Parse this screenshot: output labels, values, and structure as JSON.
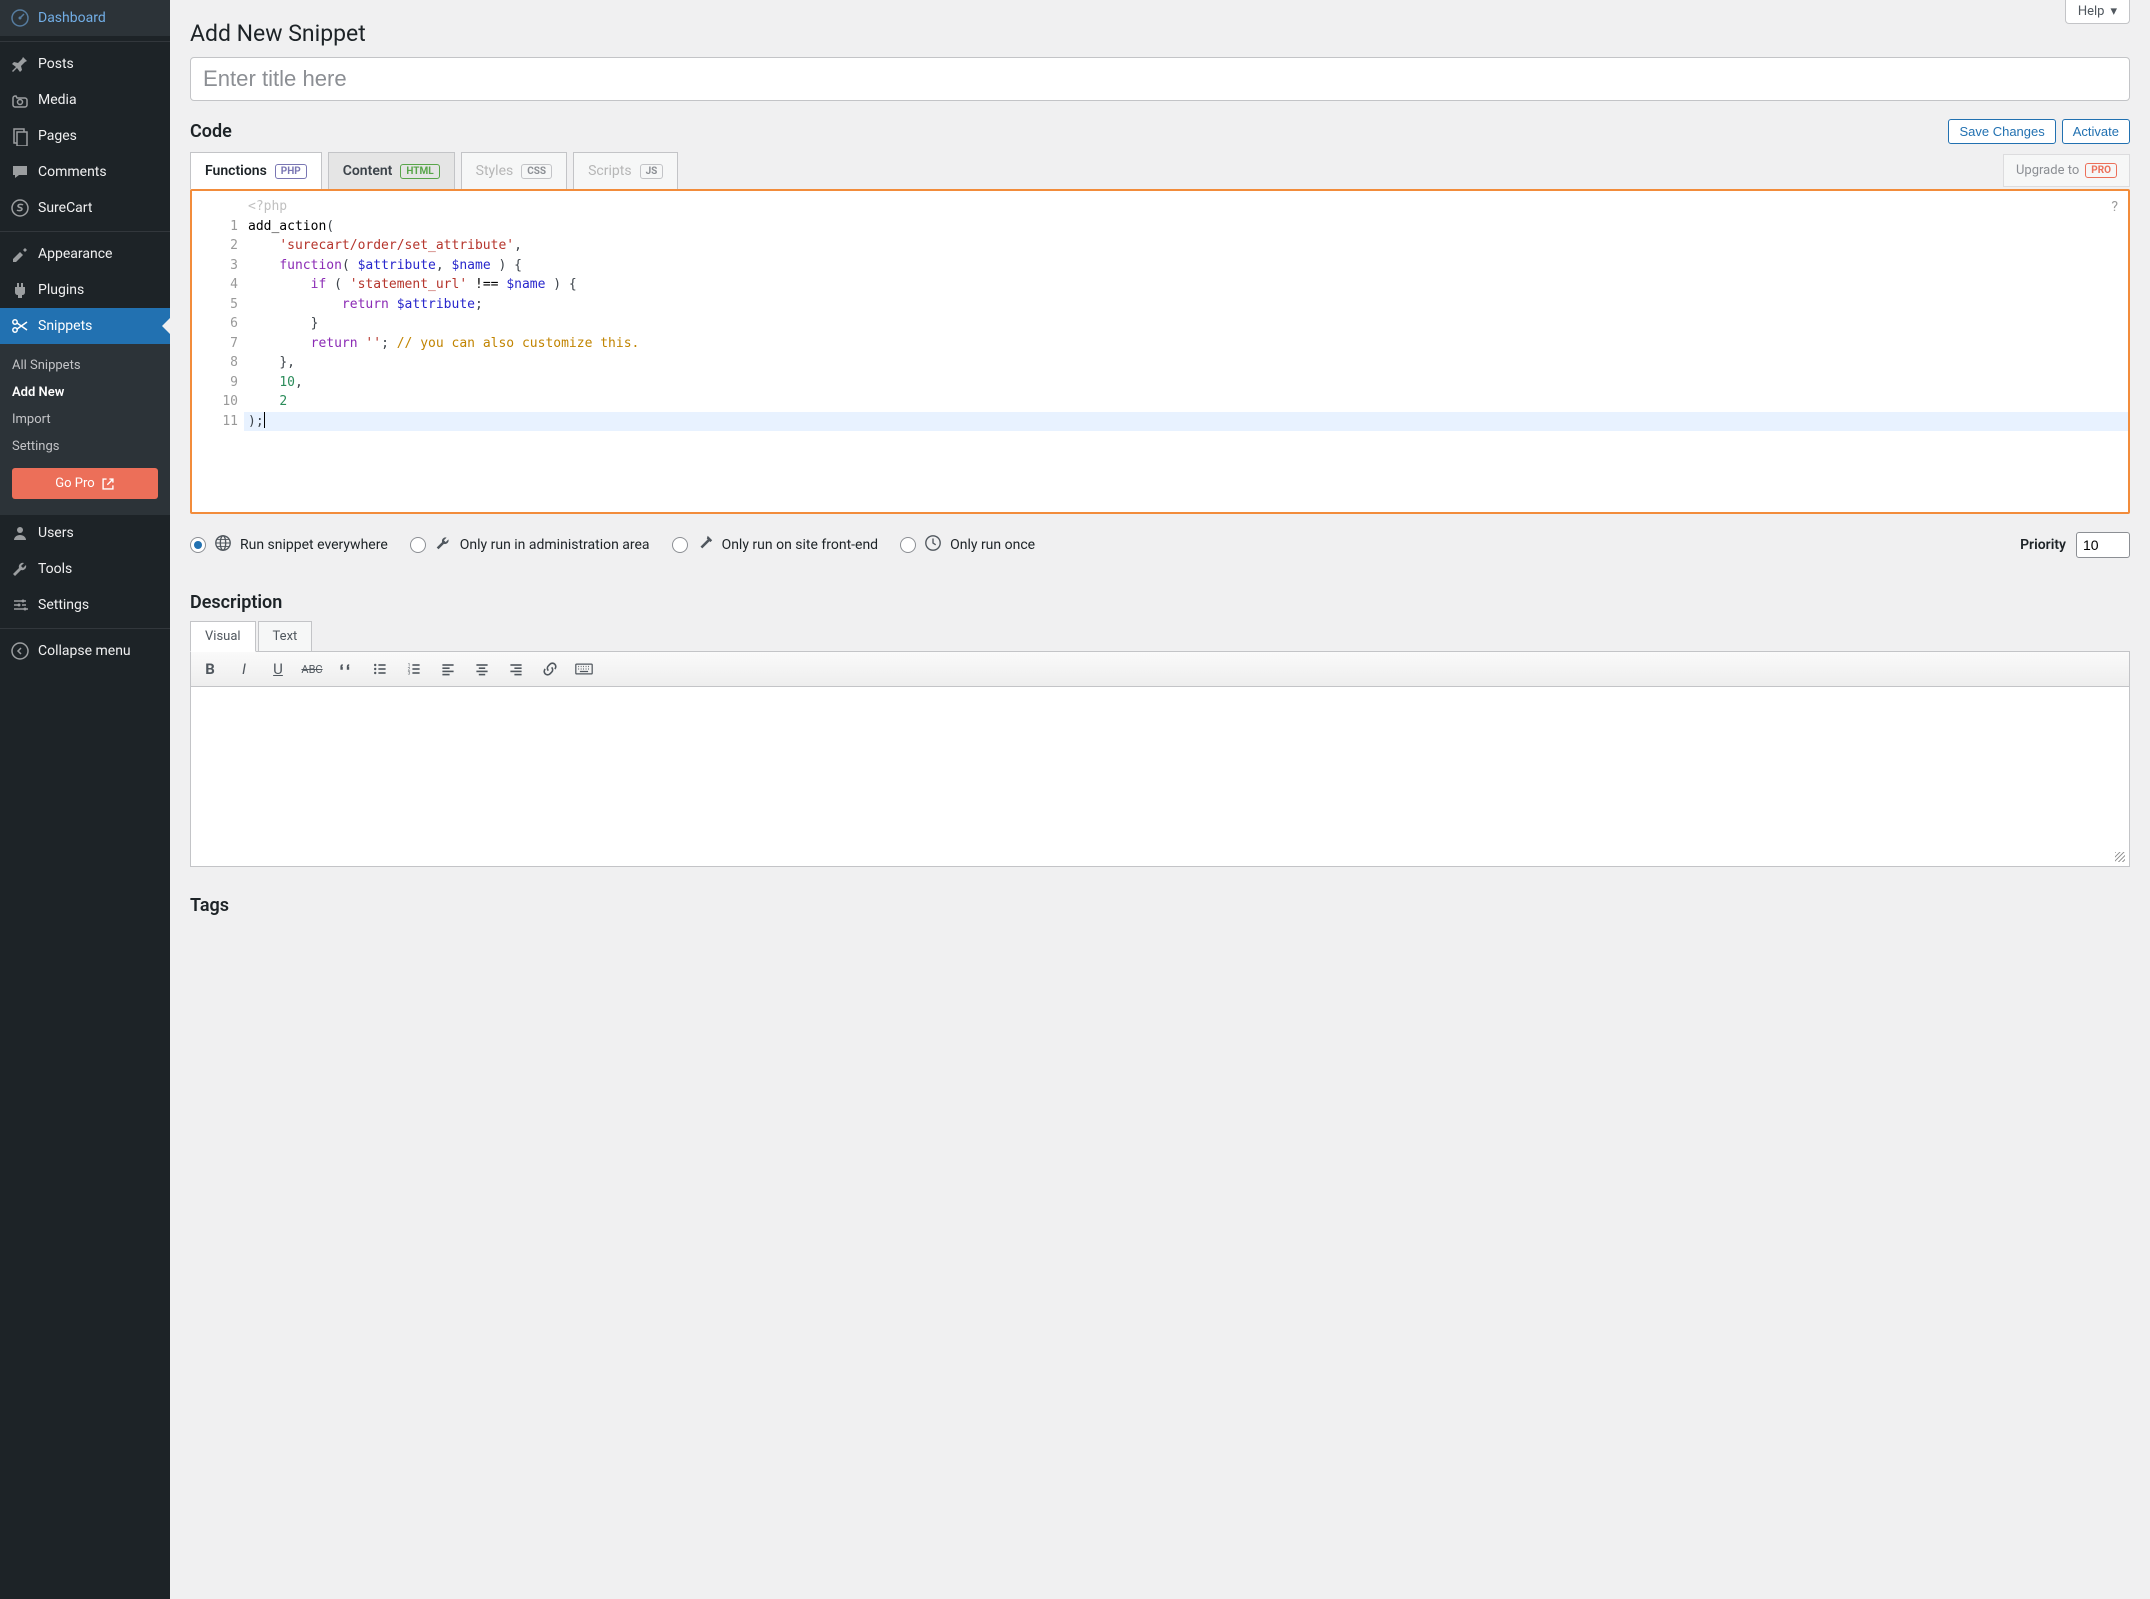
{
  "help_label": "Help",
  "page_title": "Add New Snippet",
  "title_placeholder": "Enter title here",
  "section_code": "Code",
  "btn_save": "Save Changes",
  "btn_activate": "Activate",
  "tabs": {
    "functions": "Functions",
    "functions_badge": "PHP",
    "content": "Content",
    "content_badge": "HTML",
    "styles": "Styles",
    "styles_badge": "CSS",
    "scripts": "Scripts",
    "scripts_badge": "JS"
  },
  "upgrade_text": "Upgrade to",
  "upgrade_badge": "PRO",
  "code": {
    "open_tag": "<?php",
    "lines": [
      "1",
      "2",
      "3",
      "4",
      "5",
      "6",
      "7",
      "8",
      "9",
      "10",
      "11"
    ],
    "l1_fn": "add_action",
    "l1_paren": "(",
    "l2_indent": "    ",
    "l2_str": "'surecart/order/set_attribute'",
    "l2_comma": ",",
    "l3_indent": "    ",
    "l3_kw": "function",
    "l3_paren1": "( ",
    "l3_var1": "$attribute",
    "l3_comma": ", ",
    "l3_var2": "$name",
    "l3_paren2": " ) {",
    "l4_indent": "        ",
    "l4_kw": "if",
    "l4_text1": " ( ",
    "l4_str": "'statement_url'",
    "l4_op": " !== ",
    "l4_var": "$name",
    "l4_text2": " ) {",
    "l5_indent": "            ",
    "l5_kw": "return",
    "l5_sp": " ",
    "l5_var": "$attribute",
    "l5_semi": ";",
    "l6_indent": "        ",
    "l6_brace": "}",
    "l7_indent": "        ",
    "l7_kw": "return",
    "l7_sp": " ",
    "l7_str": "''",
    "l7_semi": "; ",
    "l7_com": "// you can also customize this.",
    "l8_indent": "    ",
    "l8_text": "},",
    "l9_indent": "    ",
    "l9_num": "10",
    "l9_comma": ",",
    "l10_indent": "    ",
    "l10_num": "2",
    "l11_text": ");"
  },
  "scope": {
    "everywhere": "Run snippet everywhere",
    "admin": "Only run in administration area",
    "frontend": "Only run on site front-end",
    "once": "Only run once"
  },
  "priority_label": "Priority",
  "priority_value": "10",
  "section_description": "Description",
  "desc_tabs": {
    "visual": "Visual",
    "text": "Text"
  },
  "section_tags": "Tags",
  "sidebar": {
    "dashboard": "Dashboard",
    "posts": "Posts",
    "media": "Media",
    "pages": "Pages",
    "comments": "Comments",
    "surecart": "SureCart",
    "appearance": "Appearance",
    "plugins": "Plugins",
    "snippets": "Snippets",
    "snippets_sub": {
      "all": "All Snippets",
      "add": "Add New",
      "import": "Import",
      "settings": "Settings"
    },
    "go_pro": "Go Pro",
    "users": "Users",
    "tools": "Tools",
    "settings": "Settings",
    "collapse": "Collapse menu"
  }
}
